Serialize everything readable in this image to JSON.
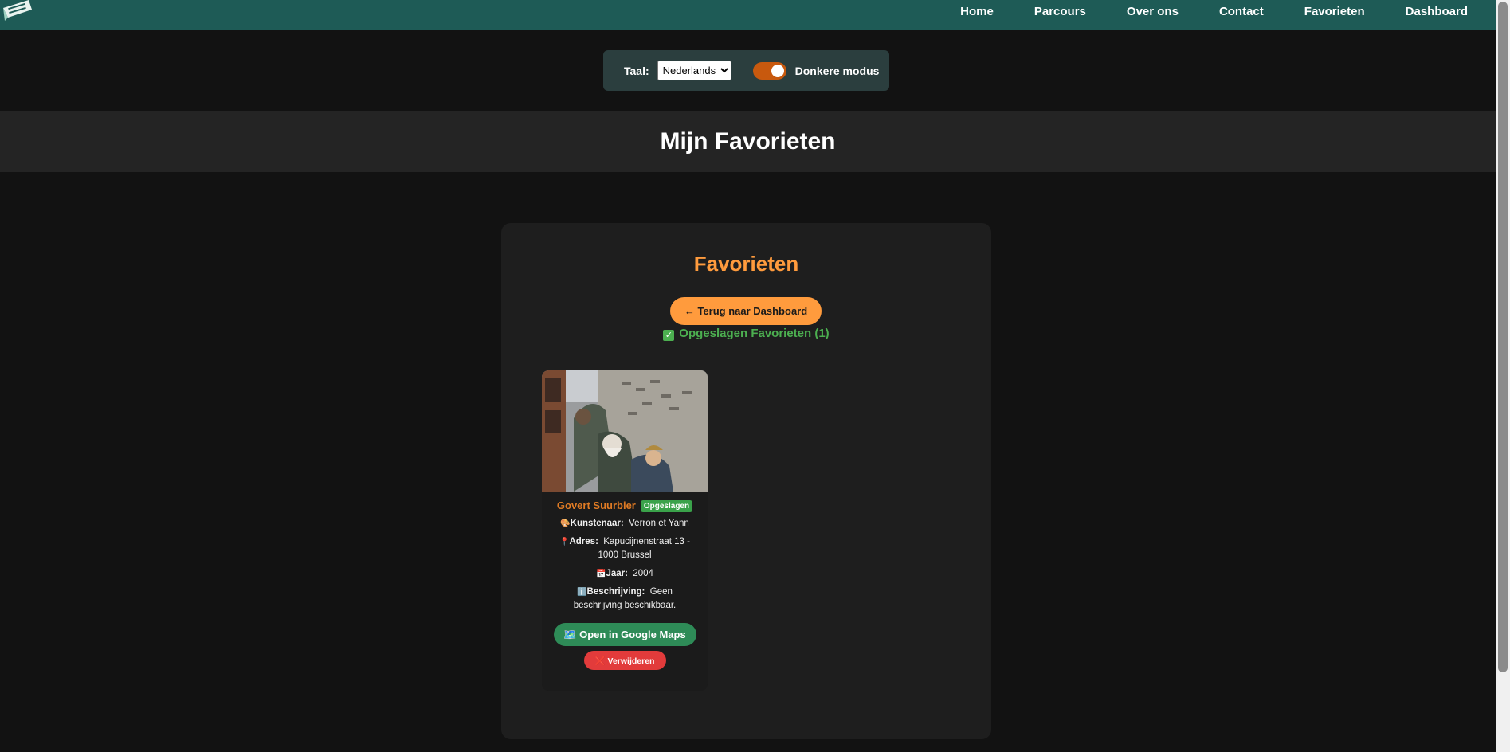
{
  "nav": {
    "logo_icon": "green-banner-logo",
    "links": [
      "Home",
      "Parcours",
      "Over ons",
      "Contact",
      "Favorieten",
      "Dashboard"
    ]
  },
  "settings": {
    "language_label": "Taal:",
    "language_selected": "Nederlands",
    "dark_mode_label": "Donkere modus",
    "dark_mode_on": true
  },
  "page": {
    "heading": "Mijn Favorieten"
  },
  "favorites": {
    "title": "Favorieten",
    "back_button": "← Terug naar Dashboard",
    "saved_label": "Opgeslagen Favorieten (1)",
    "items": [
      {
        "title": "Govert Suurbier",
        "badge": "Opgeslagen",
        "artist_label": "Kunstenaar:",
        "artist": "Verron et Yann",
        "address_label": "Adres:",
        "address": "Kapucijnenstraat 13 - 1000 Brussel",
        "year_label": "Jaar:",
        "year": "2004",
        "description_label": "Beschrijving:",
        "description": "Geen beschrijving beschikbaar.",
        "maps_button": "Open in Google Maps",
        "remove_button": "Verwijderen"
      }
    ]
  },
  "colors": {
    "navbar": "#1e5b56",
    "accent_orange": "#ff9b3d",
    "saved_green": "#4caf50",
    "maps_green": "#2e8b57",
    "remove_red": "#e23b3b"
  }
}
